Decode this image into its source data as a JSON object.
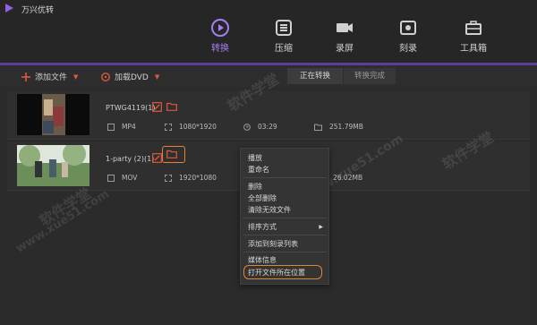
{
  "app": {
    "title": "万兴优转"
  },
  "nav": {
    "tabs": [
      {
        "label": "转换",
        "icon": "convert-icon",
        "active": true
      },
      {
        "label": "压缩",
        "icon": "compress-icon",
        "active": false
      },
      {
        "label": "录屏",
        "icon": "record-screen-icon",
        "active": false
      },
      {
        "label": "刻录",
        "icon": "burn-disc-icon",
        "active": false
      },
      {
        "label": "工具箱",
        "icon": "toolbox-icon",
        "active": false
      }
    ]
  },
  "toolbar": {
    "add_file": "添加文件",
    "load_dvd": "加载DVD",
    "tab_converting": "正在转换",
    "tab_done": "转换完成"
  },
  "files": [
    {
      "name": "PTWG4119(1)",
      "format": "MP4",
      "resolution": "1080*1920",
      "duration": "03:29",
      "size": "251.79MB"
    },
    {
      "name": "1-party (2)(1)",
      "format": "MOV",
      "resolution": "1920*1080",
      "duration": "",
      "size": "26.02MB"
    }
  ],
  "context_menu": {
    "items": [
      "播放",
      "重命名",
      "删除",
      "全部删除",
      "清除无效文件",
      "排序方式",
      "添加到刻录列表",
      "媒体信息",
      "打开文件所在位置"
    ]
  },
  "watermark": {
    "texts": [
      "软件学堂",
      "www.xue51.com",
      "软件学堂",
      "软件学堂",
      "www.xue51.com"
    ]
  },
  "colors": {
    "accent_purple": "#a57ff0",
    "accent_orange": "#e0583d",
    "highlight": "#e08534"
  }
}
